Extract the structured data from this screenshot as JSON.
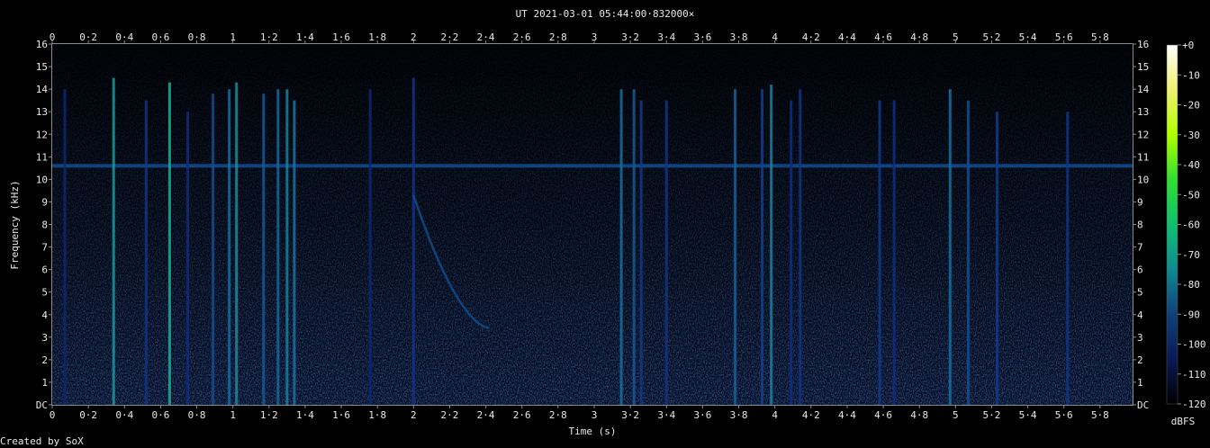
{
  "chart_data": {
    "type": "heatmap",
    "title": "UT 2021-03-01 05:44:00·832000×",
    "xlabel": "Time (s)",
    "ylabel": "Frequency (kHz)",
    "xlim": [
      0,
      5.98
    ],
    "ylim": [
      0,
      16
    ],
    "x_ticks": [
      "0",
      "0·2",
      "0·4",
      "0·6",
      "0·8",
      "1",
      "1·2",
      "1·4",
      "1·6",
      "1·8",
      "2",
      "2·2",
      "2·4",
      "2·6",
      "2·8",
      "3",
      "3·2",
      "3·4",
      "3·6",
      "3·8",
      "4",
      "4·2",
      "4·4",
      "4·6",
      "4·8",
      "5",
      "5·2",
      "5·4",
      "5·6",
      "5·8"
    ],
    "y_ticks": [
      "DC",
      "1",
      "2",
      "3",
      "4",
      "5",
      "6",
      "7",
      "8",
      "9",
      "10",
      "11",
      "12",
      "13",
      "14",
      "15",
      "16"
    ],
    "colorbar": {
      "label": "dBFS",
      "ticks": [
        "+0",
        "-10",
        "-20",
        "-30",
        "-40",
        "-50",
        "-60",
        "-70",
        "-80",
        "-90",
        "-100",
        "-110",
        "-120"
      ],
      "colors": [
        "#ffffff",
        "#f0f070",
        "#b0ff00",
        "#30e030",
        "#10c070",
        "#108a90",
        "#10407a",
        "#0a1a55",
        "#000000"
      ]
    },
    "background_color": "#02061a",
    "carrier_tone": {
      "freq_khz": 10.6,
      "level_dbfs": -100
    },
    "broadband_bursts": [
      {
        "t": 0.07,
        "fmax": 14.0,
        "level": -108
      },
      {
        "t": 0.34,
        "fmax": 14.5,
        "level": -88
      },
      {
        "t": 0.52,
        "fmax": 13.5,
        "level": -104
      },
      {
        "t": 0.65,
        "fmax": 14.3,
        "level": -85
      },
      {
        "t": 0.75,
        "fmax": 13.0,
        "level": -106
      },
      {
        "t": 0.89,
        "fmax": 13.8,
        "level": -100
      },
      {
        "t": 0.98,
        "fmax": 14.0,
        "level": -95
      },
      {
        "t": 1.02,
        "fmax": 14.3,
        "level": -90
      },
      {
        "t": 1.17,
        "fmax": 13.8,
        "level": -98
      },
      {
        "t": 1.25,
        "fmax": 14.0,
        "level": -96
      },
      {
        "t": 1.3,
        "fmax": 14.0,
        "level": -92
      },
      {
        "t": 1.34,
        "fmax": 13.5,
        "level": -94
      },
      {
        "t": 1.76,
        "fmax": 14.0,
        "level": -108
      },
      {
        "t": 2.0,
        "fmax": 14.5,
        "level": -104
      },
      {
        "t": 3.15,
        "fmax": 14.0,
        "level": -95
      },
      {
        "t": 3.22,
        "fmax": 14.0,
        "level": -98
      },
      {
        "t": 3.26,
        "fmax": 13.5,
        "level": -103
      },
      {
        "t": 3.4,
        "fmax": 13.5,
        "level": -104
      },
      {
        "t": 3.78,
        "fmax": 14.0,
        "level": -97
      },
      {
        "t": 3.93,
        "fmax": 14.0,
        "level": -102
      },
      {
        "t": 3.98,
        "fmax": 14.2,
        "level": -92
      },
      {
        "t": 4.09,
        "fmax": 13.5,
        "level": -105
      },
      {
        "t": 4.14,
        "fmax": 14.0,
        "level": -104
      },
      {
        "t": 4.58,
        "fmax": 13.5,
        "level": -103
      },
      {
        "t": 4.66,
        "fmax": 13.5,
        "level": -105
      },
      {
        "t": 4.97,
        "fmax": 14.0,
        "level": -95
      },
      {
        "t": 5.07,
        "fmax": 13.5,
        "level": -100
      },
      {
        "t": 5.23,
        "fmax": 13.0,
        "level": -103
      },
      {
        "t": 5.62,
        "fmax": 13.0,
        "level": -104
      }
    ],
    "dispersed_whistler": {
      "t_start": 2.0,
      "t_end": 2.42,
      "f_start_khz": 9.3,
      "f_end_khz": 3.4,
      "level": -100
    }
  },
  "footer": {
    "credit": "Created by SoX"
  }
}
